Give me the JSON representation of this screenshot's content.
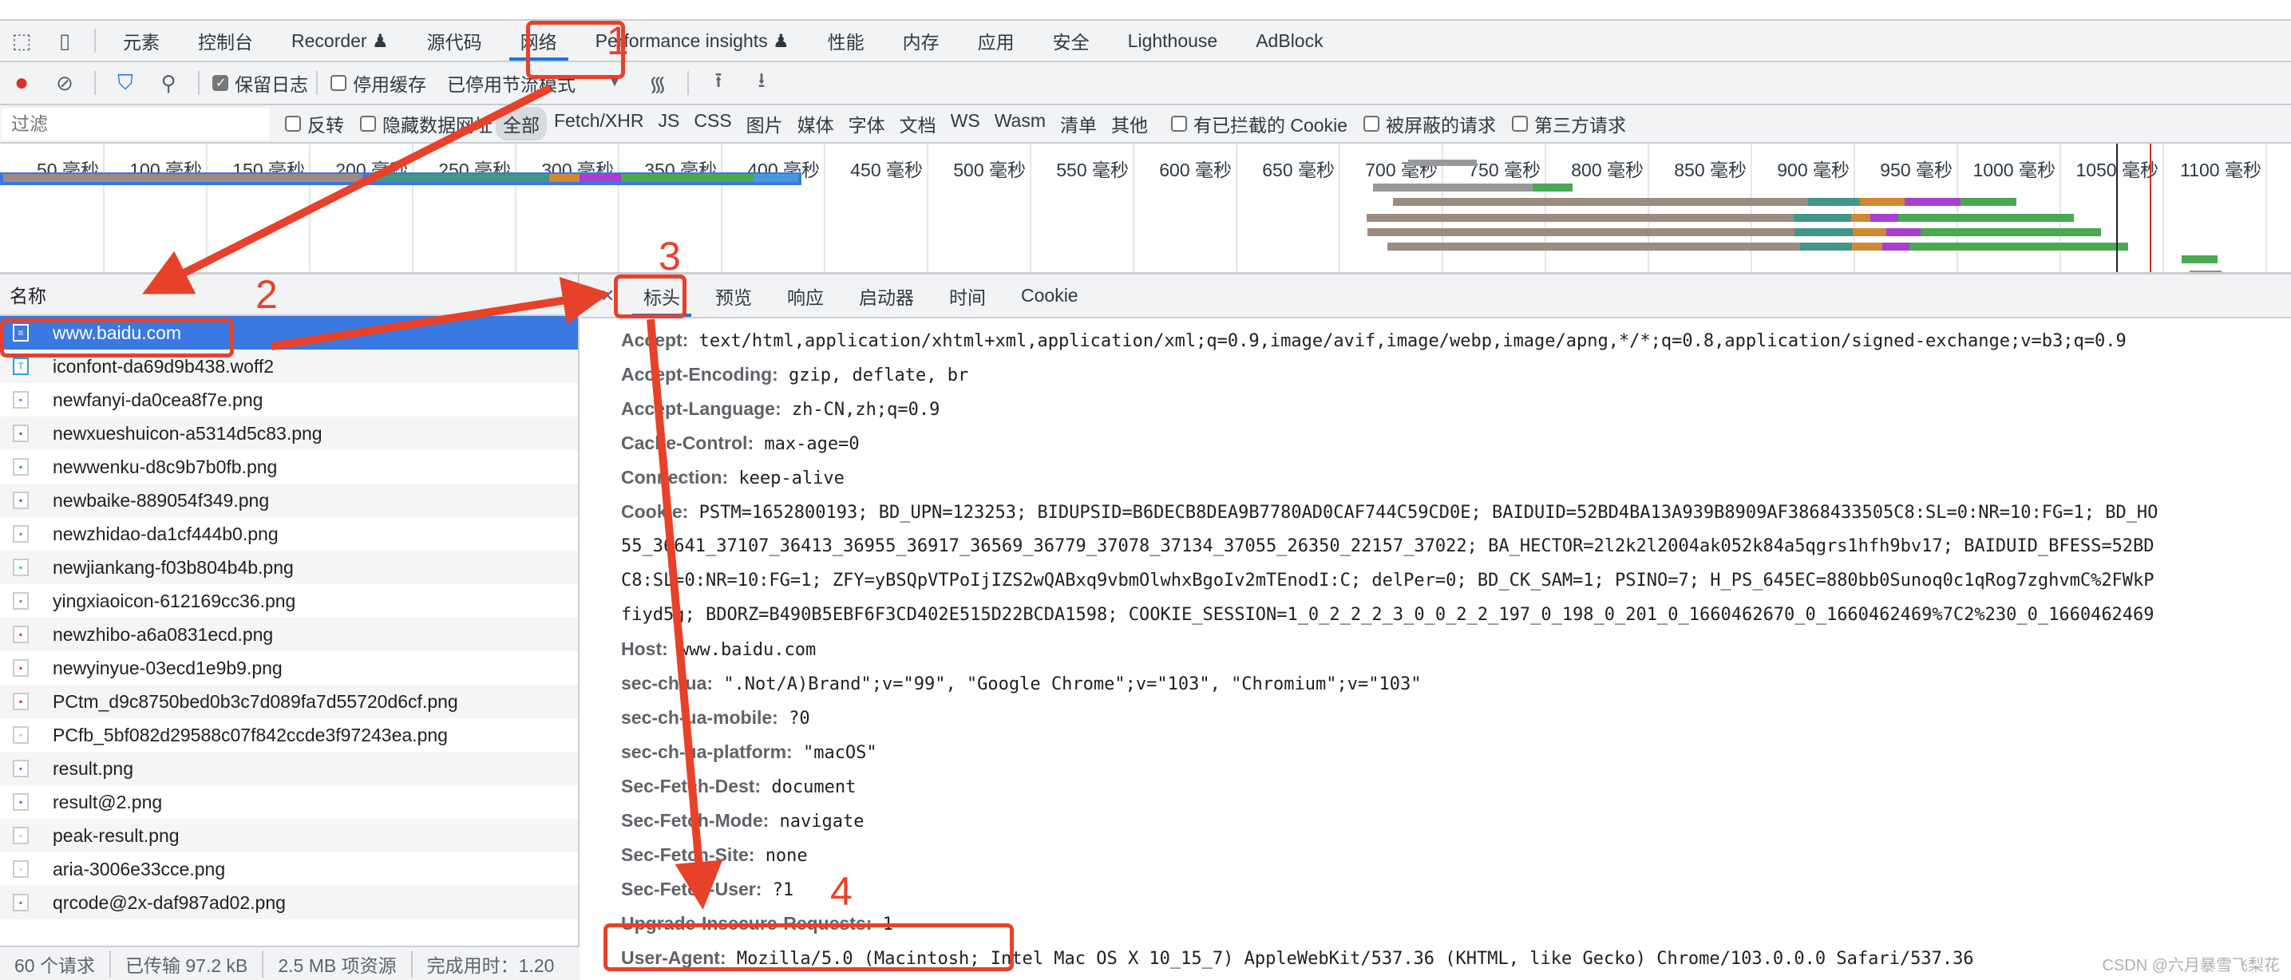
{
  "tabs": [
    "元素",
    "控制台",
    "Recorder ♟",
    "源代码",
    "网络",
    "Performance insights ♟",
    "性能",
    "内存",
    "应用",
    "安全",
    "Lighthouse",
    "AdBlock"
  ],
  "active_tab": "网络",
  "toolbar": {
    "preserve_log": "保留日志",
    "disable_cache": "停用缓存",
    "throttling": "已停用节流模式"
  },
  "filter": {
    "placeholder": "过滤",
    "invert": "反转",
    "hide_data_urls": "隐藏数据网址",
    "types": [
      "全部",
      "Fetch/XHR",
      "JS",
      "CSS",
      "图片",
      "媒体",
      "字体",
      "文档",
      "WS",
      "Wasm",
      "清单",
      "其他"
    ],
    "blocked_cookies": "有已拦截的 Cookie",
    "blocked_requests": "被屏蔽的请求",
    "third_party": "第三方请求"
  },
  "timeline": {
    "ticks": [
      "50 毫秒",
      "100 毫秒",
      "150 毫秒",
      "200 毫秒",
      "250 毫秒",
      "300 毫秒",
      "350 毫秒",
      "400 毫秒",
      "450 毫秒",
      "500 毫秒",
      "550 毫秒",
      "600 毫秒",
      "650 毫秒",
      "700 毫秒",
      "750 毫秒",
      "800 毫秒",
      "850 毫秒",
      "900 毫秒",
      "950 毫秒",
      "1000 毫秒",
      "1050 毫秒",
      "1100 毫秒"
    ]
  },
  "requests": {
    "header": "名称",
    "items": [
      "www.baidu.com",
      "iconfont-da69d9b438.woff2",
      "newfanyi-da0cea8f7e.png",
      "newxueshuicon-a5314d5c83.png",
      "newwenku-d8c9b7b0fb.png",
      "newbaike-889054f349.png",
      "newzhidao-da1cf444b0.png",
      "newjiankang-f03b804b4b.png",
      "yingxiaoicon-612169cc36.png",
      "newzhibo-a6a0831ecd.png",
      "newyinyue-03ecd1e9b9.png",
      "PCtm_d9c8750bed0b3c7d089fa7d55720d6cf.png",
      "PCfb_5bf082d29588c07f842ccde3f97243ea.png",
      "result.png",
      "result@2.png",
      "peak-result.png",
      "aria-3006e33cce.png",
      "qrcode@2x-daf987ad02.png"
    ]
  },
  "status": {
    "requests": "60 个请求",
    "transferred": "已传输 97.2 kB",
    "resources": "2.5 MB 项资源",
    "finish": "完成用时：1.20"
  },
  "detail_tabs": [
    "标头",
    "预览",
    "响应",
    "启动器",
    "时间",
    "Cookie"
  ],
  "headers": [
    {
      "k": "Accept:",
      "v": "text/html,application/xhtml+xml,application/xml;q=0.9,image/avif,image/webp,image/apng,*/*;q=0.8,application/signed-exchange;v=b3;q=0.9"
    },
    {
      "k": "Accept-Encoding:",
      "v": "gzip, deflate, br"
    },
    {
      "k": "Accept-Language:",
      "v": "zh-CN,zh;q=0.9"
    },
    {
      "k": "Cache-Control:",
      "v": "max-age=0"
    },
    {
      "k": "Connection:",
      "v": "keep-alive"
    },
    {
      "k": "Cookie:",
      "v": "PSTM=1652800193; BD_UPN=123253; BIDUPSID=B6DECB8DEA9B7780AD0CAF744C59CD0E; BAIDUID=52BD4BA13A939B8909AF3868433505C8:SL=0:NR=10:FG=1; BD_HO"
    },
    {
      "k": "",
      "v": "55_36641_37107_36413_36955_36917_36569_36779_37078_37134_37055_26350_22157_37022; BA_HECTOR=2l2k2l2004ak052k84a5qgrs1hfh9bv17; BAIDUID_BFESS=52BD"
    },
    {
      "k": "",
      "v": "C8:SL=0:NR=10:FG=1; ZFY=yBSQpVTPoIjIZS2wQABxq9vbmOlwhxBgoIv2mTEnodI:C; delPer=0; BD_CK_SAM=1; PSINO=7; H_PS_645EC=880bb0Sunoq0c1qRog7zghvmC%2FWkP"
    },
    {
      "k": "",
      "v": "fiyd5g; BDORZ=B490B5EBF6F3CD402E515D22BCDA1598; COOKIE_SESSION=1_0_2_2_2_3_0_0_2_2_197_0_198_0_201_0_1660462670_0_1660462469%7C2%230_0_1660462469"
    },
    {
      "k": "Host:",
      "v": "www.baidu.com"
    },
    {
      "k": "sec-ch-ua:",
      "v": "\".Not/A)Brand\";v=\"99\", \"Google Chrome\";v=\"103\", \"Chromium\";v=\"103\""
    },
    {
      "k": "sec-ch-ua-mobile:",
      "v": "?0"
    },
    {
      "k": "sec-ch-ua-platform:",
      "v": "\"macOS\""
    },
    {
      "k": "Sec-Fetch-Dest:",
      "v": "document"
    },
    {
      "k": "Sec-Fetch-Mode:",
      "v": "navigate"
    },
    {
      "k": "Sec-Fetch-Site:",
      "v": "none"
    },
    {
      "k": "Sec-Fetch-User:",
      "v": "?1"
    },
    {
      "k": "Upgrade-Insecure-Requests:",
      "v": "1"
    },
    {
      "k": "User-Agent:",
      "v": "Mozilla/5.0 (Macintosh; Intel Mac OS X 10_15_7) AppleWebKit/537.36 (KHTML, like Gecko) Chrome/103.0.0.0 Safari/537.36"
    }
  ],
  "annotations": {
    "n1": "1",
    "n2": "2",
    "n3": "3",
    "n4": "4",
    "color": "#e8412a"
  },
  "watermark": "CSDN @六月暴雪飞梨花"
}
